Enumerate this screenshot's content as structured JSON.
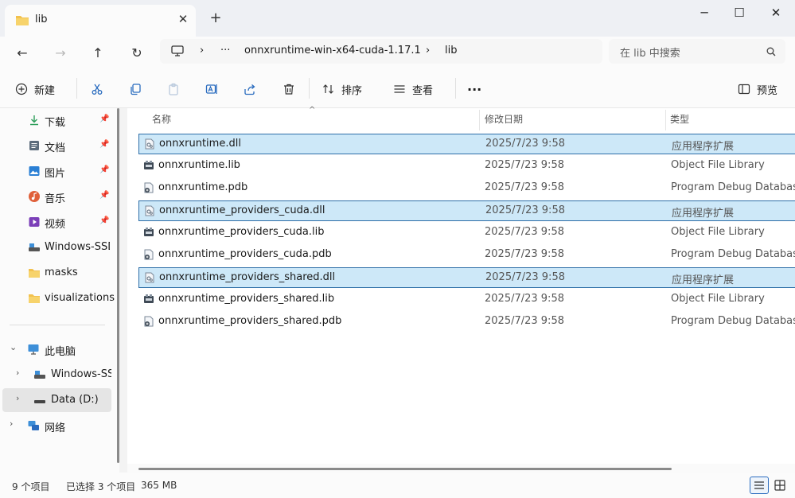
{
  "window": {
    "tab_title": "lib",
    "tab_close": "✕",
    "new_tab": "+",
    "minimize": "─",
    "maximize": "☐",
    "close": "✕"
  },
  "address_bar": {
    "back": "←",
    "forward": "→",
    "up": "↑",
    "refresh": "↻",
    "monitor_icon": "monitor-icon",
    "chevron": "›",
    "ellipsis": "···",
    "path_segments": [
      "onnxruntime-win-x64-cuda-1.17.1",
      "lib"
    ],
    "search_placeholder": "在 lib 中搜索"
  },
  "toolbar": {
    "new_label": "新建",
    "sort_label": "排序",
    "view_label": "查看",
    "more": "···",
    "preview_label": "预览"
  },
  "sidebar": {
    "quick_access": [
      {
        "label": "下载",
        "icon": "download-icon",
        "color": "#2e9e5b"
      },
      {
        "label": "文档",
        "icon": "document-icon",
        "color": "#5b6b7b"
      },
      {
        "label": "图片",
        "icon": "picture-icon",
        "color": "#2a7fd4"
      },
      {
        "label": "音乐",
        "icon": "music-icon",
        "color": "#e0603a"
      },
      {
        "label": "视频",
        "icon": "video-icon",
        "color": "#7b3fb8"
      },
      {
        "label": "Windows-SSD",
        "icon": "drive-icon",
        "color": "#3a3a3a"
      },
      {
        "label": "masks",
        "icon": "folder-icon",
        "color": "#f2c14e"
      },
      {
        "label": "visualizations",
        "icon": "folder-icon",
        "color": "#f2c14e"
      }
    ],
    "this_pc": {
      "label": "此电脑",
      "chevron": "⌄"
    },
    "drives": [
      {
        "label": "Windows-SSD",
        "chevron": "›"
      },
      {
        "label": "Data (D:)",
        "chevron": "›"
      }
    ],
    "network": {
      "label": "网络",
      "chevron": "›"
    }
  },
  "file_list": {
    "columns": {
      "name": "名称",
      "date": "修改日期",
      "type": "类型"
    },
    "sort_caret": "^",
    "rows": [
      {
        "name": "onnxruntime.dll",
        "date": "2025/7/23 9:58",
        "type": "应用程序扩展",
        "selected": true,
        "icon": "dll-icon"
      },
      {
        "name": "onnxruntime.lib",
        "date": "2025/7/23 9:58",
        "type": "Object File Library",
        "selected": false,
        "icon": "lib-icon"
      },
      {
        "name": "onnxruntime.pdb",
        "date": "2025/7/23 9:58",
        "type": "Program Debug Database",
        "selected": false,
        "icon": "pdb-icon"
      },
      {
        "name": "onnxruntime_providers_cuda.dll",
        "date": "2025/7/23 9:58",
        "type": "应用程序扩展",
        "selected": true,
        "icon": "dll-icon"
      },
      {
        "name": "onnxruntime_providers_cuda.lib",
        "date": "2025/7/23 9:58",
        "type": "Object File Library",
        "selected": false,
        "icon": "lib-icon"
      },
      {
        "name": "onnxruntime_providers_cuda.pdb",
        "date": "2025/7/23 9:58",
        "type": "Program Debug Database",
        "selected": false,
        "icon": "pdb-icon"
      },
      {
        "name": "onnxruntime_providers_shared.dll",
        "date": "2025/7/23 9:58",
        "type": "应用程序扩展",
        "selected": true,
        "icon": "dll-icon"
      },
      {
        "name": "onnxruntime_providers_shared.lib",
        "date": "2025/7/23 9:58",
        "type": "Object File Library",
        "selected": false,
        "icon": "lib-icon"
      },
      {
        "name": "onnxruntime_providers_shared.pdb",
        "date": "2025/7/23 9:58",
        "type": "Program Debug Database",
        "selected": false,
        "icon": "pdb-icon"
      }
    ]
  },
  "status_bar": {
    "item_count": "9 个项目",
    "selection": "已选择 3 个项目",
    "size": "365 MB"
  },
  "colors": {
    "accent": "#2a6cbf",
    "selection_bg": "#cde8f8",
    "selection_border": "#2e6fa8",
    "folder": "#f2c14e"
  }
}
